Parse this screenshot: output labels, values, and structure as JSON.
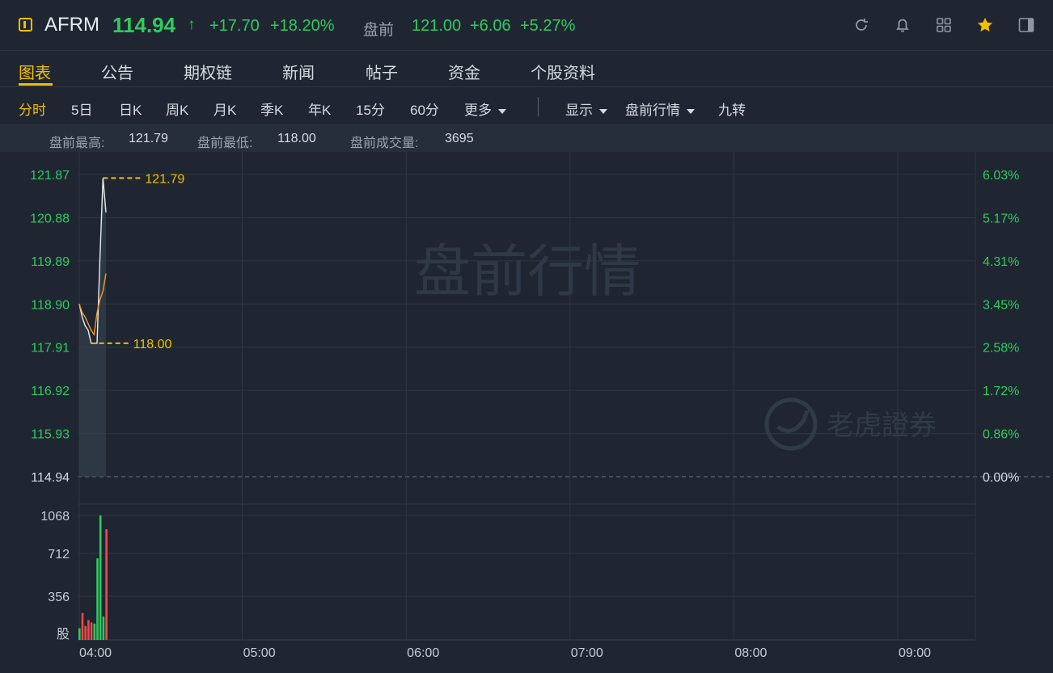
{
  "header": {
    "symbol": "AFRM",
    "price": "114.94",
    "price_arrow": "↑",
    "change": "+17.70",
    "change_pct": "+18.20%",
    "premarket_label": "盘前",
    "premarket_price": "121.00",
    "premarket_change": "+6.06",
    "premarket_change_pct": "+5.27%",
    "icons": [
      "refresh-icon",
      "bell-icon",
      "grid-icon",
      "star-icon",
      "panel-icon"
    ]
  },
  "nav": {
    "tabs": [
      "图表",
      "公告",
      "期权链",
      "新闻",
      "帖子",
      "资金",
      "个股资料"
    ],
    "active": 0
  },
  "periods": {
    "items": [
      "分时",
      "5日",
      "日K",
      "周K",
      "月K",
      "季K",
      "年K",
      "15分",
      "60分",
      "更多"
    ],
    "active": 0,
    "display": "显示",
    "session": "盘前行情",
    "nine_turn": "九转"
  },
  "stats": {
    "high_label": "盘前最高:",
    "high": "121.79",
    "low_label": "盘前最低:",
    "low": "118.00",
    "volume_label": "盘前成交量:",
    "volume": "3695"
  },
  "watermark": "盘前行情",
  "brand": "老虎證券",
  "colors": {
    "up": "#2fcb5f",
    "down": "#f04848",
    "accent": "#f0c000",
    "price_line": "#e8ecf1",
    "avg_line": "#f39b28"
  },
  "chart_data": {
    "type": "line",
    "base_price": 114.94,
    "price_axis_labels": [
      "121.87",
      "120.88",
      "119.89",
      "118.90",
      "117.91",
      "116.92",
      "115.93",
      "114.94"
    ],
    "pct_axis_labels": [
      "6.03%",
      "5.17%",
      "4.31%",
      "3.45%",
      "2.58%",
      "1.72%",
      "0.86%",
      "0.00%"
    ],
    "x_tick_labels": [
      "04:00",
      "05:00",
      "06:00",
      "07:00",
      "08:00",
      "09:00"
    ],
    "ylim": [
      114.94,
      121.87
    ],
    "high_marker": "121.79",
    "low_marker": "118.00",
    "price_series": [
      118.9,
      118.6,
      118.4,
      118.3,
      118.0,
      118.0,
      118.0,
      120.0,
      121.79,
      121.0
    ],
    "avg_series": [
      118.9,
      118.7,
      118.6,
      118.45,
      118.3,
      118.2,
      118.7,
      119.0,
      119.2,
      119.6
    ],
    "volume_axis_labels": [
      "1068",
      "712",
      "356",
      "股"
    ],
    "volume_max": 1068,
    "volumes": [
      {
        "v": 100,
        "up": true
      },
      {
        "v": 230,
        "up": false
      },
      {
        "v": 120,
        "up": false
      },
      {
        "v": 170,
        "up": false
      },
      {
        "v": 150,
        "up": false
      },
      {
        "v": 140,
        "up": true
      },
      {
        "v": 700,
        "up": true
      },
      {
        "v": 1068,
        "up": true
      },
      {
        "v": 200,
        "up": true
      },
      {
        "v": 950,
        "up": false
      }
    ]
  }
}
